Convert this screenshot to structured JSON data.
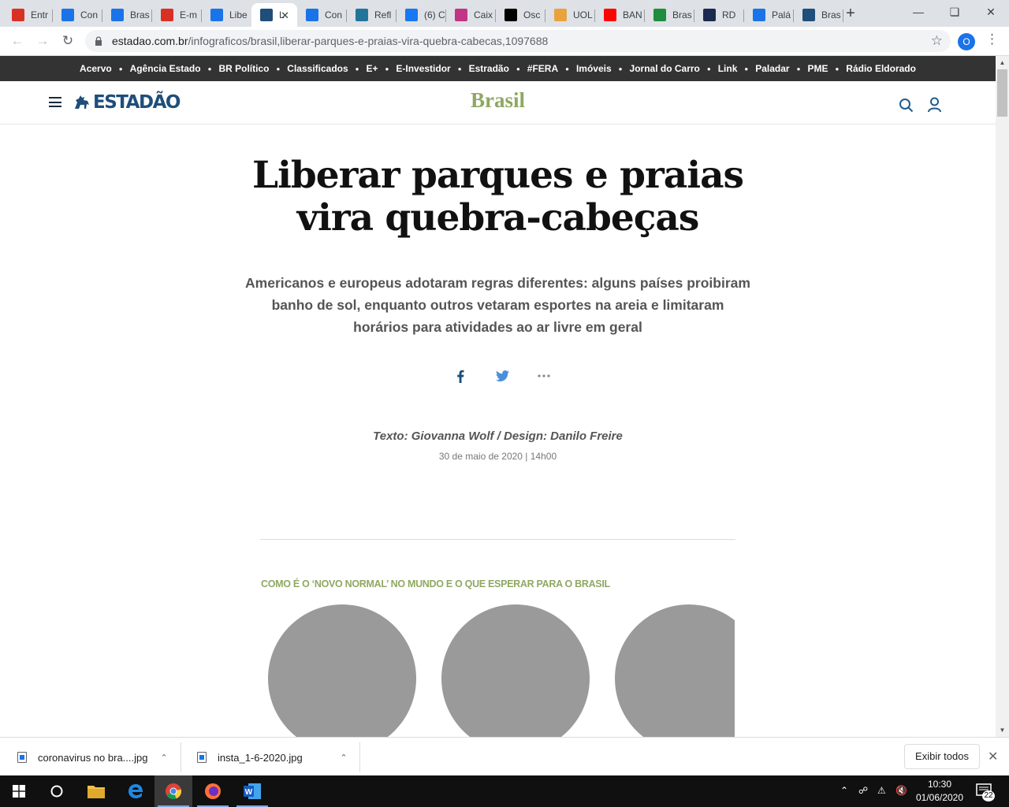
{
  "browser": {
    "tabs": [
      {
        "title": "Entr",
        "favicon": "gmail-icon",
        "color": "#d93025"
      },
      {
        "title": "Con",
        "favicon": "check-icon",
        "color": "#1a73e8"
      },
      {
        "title": "Bras",
        "favicon": "check-icon",
        "color": "#1a73e8"
      },
      {
        "title": "E-m",
        "favicon": "gmail-icon",
        "color": "#d93025"
      },
      {
        "title": "Libe",
        "favicon": "check-icon",
        "color": "#1a73e8"
      },
      {
        "title": "L",
        "favicon": "estadao-icon",
        "color": "#1f4e7a",
        "active": true
      },
      {
        "title": "Con",
        "favicon": "check-icon",
        "color": "#1a73e8"
      },
      {
        "title": "Refl",
        "favicon": "wordpress-icon",
        "color": "#21759b"
      },
      {
        "title": "(6) C",
        "favicon": "facebook-icon",
        "color": "#1877f2"
      },
      {
        "title": "Caix",
        "favicon": "instagram-icon",
        "color": "#c13584"
      },
      {
        "title": "Osc",
        "favicon": "od-icon",
        "color": "#000000"
      },
      {
        "title": "UOL",
        "favicon": "uol-icon",
        "color": "#e8a33d"
      },
      {
        "title": "BAN",
        "favicon": "youtube-icon",
        "color": "#ff0000"
      },
      {
        "title": "Bras",
        "favicon": "green-circle-icon",
        "color": "#1e8e3e"
      },
      {
        "title": "RD",
        "favicon": "rd-icon",
        "color": "#1b2a4e"
      },
      {
        "title": "Palá",
        "favicon": "ar-icon",
        "color": "#1a73e8"
      },
      {
        "title": "Bras",
        "favicon": "estadao-icon",
        "color": "#1f4e7a"
      }
    ],
    "new_tab_label": "+",
    "url_host": "estadao.com.br",
    "url_path": "/infograficos/brasil,liberar-parques-e-praias-vira-quebra-cabecas,1097688",
    "profile_initial": "O"
  },
  "site": {
    "top_links": [
      "Acervo",
      "Agência Estado",
      "BR Político",
      "Classificados",
      "E+",
      "E-Investidor",
      "Estradão",
      "#FERA",
      "Imóveis",
      "Jornal do Carro",
      "Link",
      "Paladar",
      "PME",
      "Rádio Eldorado"
    ],
    "logo_text": "ESTADÃO",
    "section": "Brasil",
    "section_color": "#8fa863"
  },
  "article": {
    "headline": "Liberar parques e praias vira quebra-cabeças",
    "dek": "Americanos e europeus adotaram regras diferentes: alguns países proibiram banho de sol, enquanto outros vetaram esportes na areia e limitaram horários para atividades ao ar livre em geral",
    "share_icons": [
      "facebook-icon",
      "twitter-icon",
      "more-icon"
    ],
    "byline": "Texto: Giovanna Wolf / Design: Danilo Freire",
    "date": "30 de maio de 2020 | 14h00",
    "kicker": "COMO É O ‘NOVO NORMAL’ NO MUNDO E O QUE ESPERAR PARA O BRASIL"
  },
  "downloads": {
    "items": [
      "coronavirus no bra....jpg",
      "insta_1-6-2020.jpg"
    ],
    "show_all": "Exibir todos"
  },
  "taskbar": {
    "time": "10:30",
    "date": "01/06/2020",
    "notifications": "22"
  }
}
